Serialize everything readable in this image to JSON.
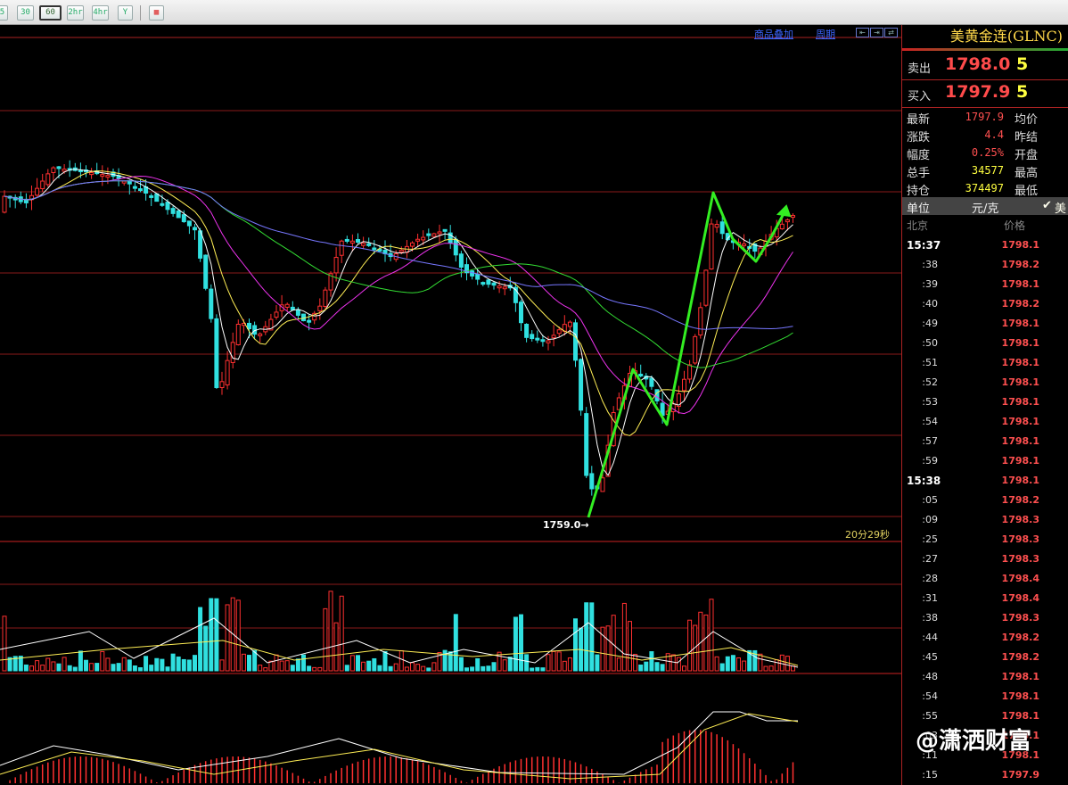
{
  "toolbar": {
    "buttons": [
      "5",
      "30",
      "60",
      "2hr",
      "4hr",
      "Y",
      "▦"
    ]
  },
  "chart": {
    "links": [
      "商品叠加",
      "周期"
    ],
    "nav_icons": [
      "⇤",
      "⇥",
      "⇄"
    ],
    "low_label": "1759.0→",
    "timer": "20分29秒"
  },
  "panel": {
    "title": "美黄金连(GLNC)",
    "sell": {
      "label": "卖出",
      "price": "1798.0",
      "vol": "5"
    },
    "buy": {
      "label": "买入",
      "price": "1797.9",
      "vol": "5"
    },
    "stats": [
      {
        "k": "最新",
        "v": "1797.9",
        "k2": "均价",
        "color": "#ff5050"
      },
      {
        "k": "涨跌",
        "v": "4.4",
        "k2": "昨结",
        "color": "#ff5050"
      },
      {
        "k": "幅度",
        "v": "0.25%",
        "k2": "开盘",
        "color": "#ff5050"
      },
      {
        "k": "总手",
        "v": "34577",
        "k2": "最高",
        "color": "#ffff40"
      },
      {
        "k": "持仓",
        "v": "374497",
        "k2": "最低",
        "color": "#ffff40"
      }
    ],
    "unit": {
      "k": "单位",
      "v": "元/克",
      "check": "✔",
      "mark": "美"
    },
    "col_head": {
      "time": "北京",
      "price": "价格"
    },
    "ticks": [
      {
        "t": "15:37",
        "p": "1798.1",
        "full": true
      },
      {
        "t": ":38",
        "p": "1798.2"
      },
      {
        "t": ":39",
        "p": "1798.1"
      },
      {
        "t": ":40",
        "p": "1798.2"
      },
      {
        "t": ":49",
        "p": "1798.1"
      },
      {
        "t": ":50",
        "p": "1798.1"
      },
      {
        "t": ":51",
        "p": "1798.1"
      },
      {
        "t": ":52",
        "p": "1798.1"
      },
      {
        "t": ":53",
        "p": "1798.1"
      },
      {
        "t": ":54",
        "p": "1798.1"
      },
      {
        "t": ":57",
        "p": "1798.1"
      },
      {
        "t": ":59",
        "p": "1798.1"
      },
      {
        "t": "15:38",
        "p": "1798.1",
        "full": true
      },
      {
        "t": ":05",
        "p": "1798.2"
      },
      {
        "t": ":09",
        "p": "1798.3"
      },
      {
        "t": ":25",
        "p": "1798.3"
      },
      {
        "t": ":27",
        "p": "1798.3"
      },
      {
        "t": ":28",
        "p": "1798.4"
      },
      {
        "t": ":31",
        "p": "1798.4"
      },
      {
        "t": ":38",
        "p": "1798.3"
      },
      {
        "t": ":44",
        "p": "1798.2"
      },
      {
        "t": ":45",
        "p": "1798.2"
      },
      {
        "t": ":48",
        "p": "1798.1"
      },
      {
        "t": ":54",
        "p": "1798.1"
      },
      {
        "t": ":55",
        "p": "1798.1"
      },
      {
        "t": ":03",
        "p": "1798.1"
      },
      {
        "t": ":11",
        "p": "1798.1"
      },
      {
        "t": ":15",
        "p": "1797.9"
      }
    ]
  },
  "watermark": "@潇洒财富",
  "colors": {
    "up": "#ff3030",
    "down": "#30e0e0",
    "grid": "#8a1a1a",
    "arrow": "#33ee22"
  }
}
